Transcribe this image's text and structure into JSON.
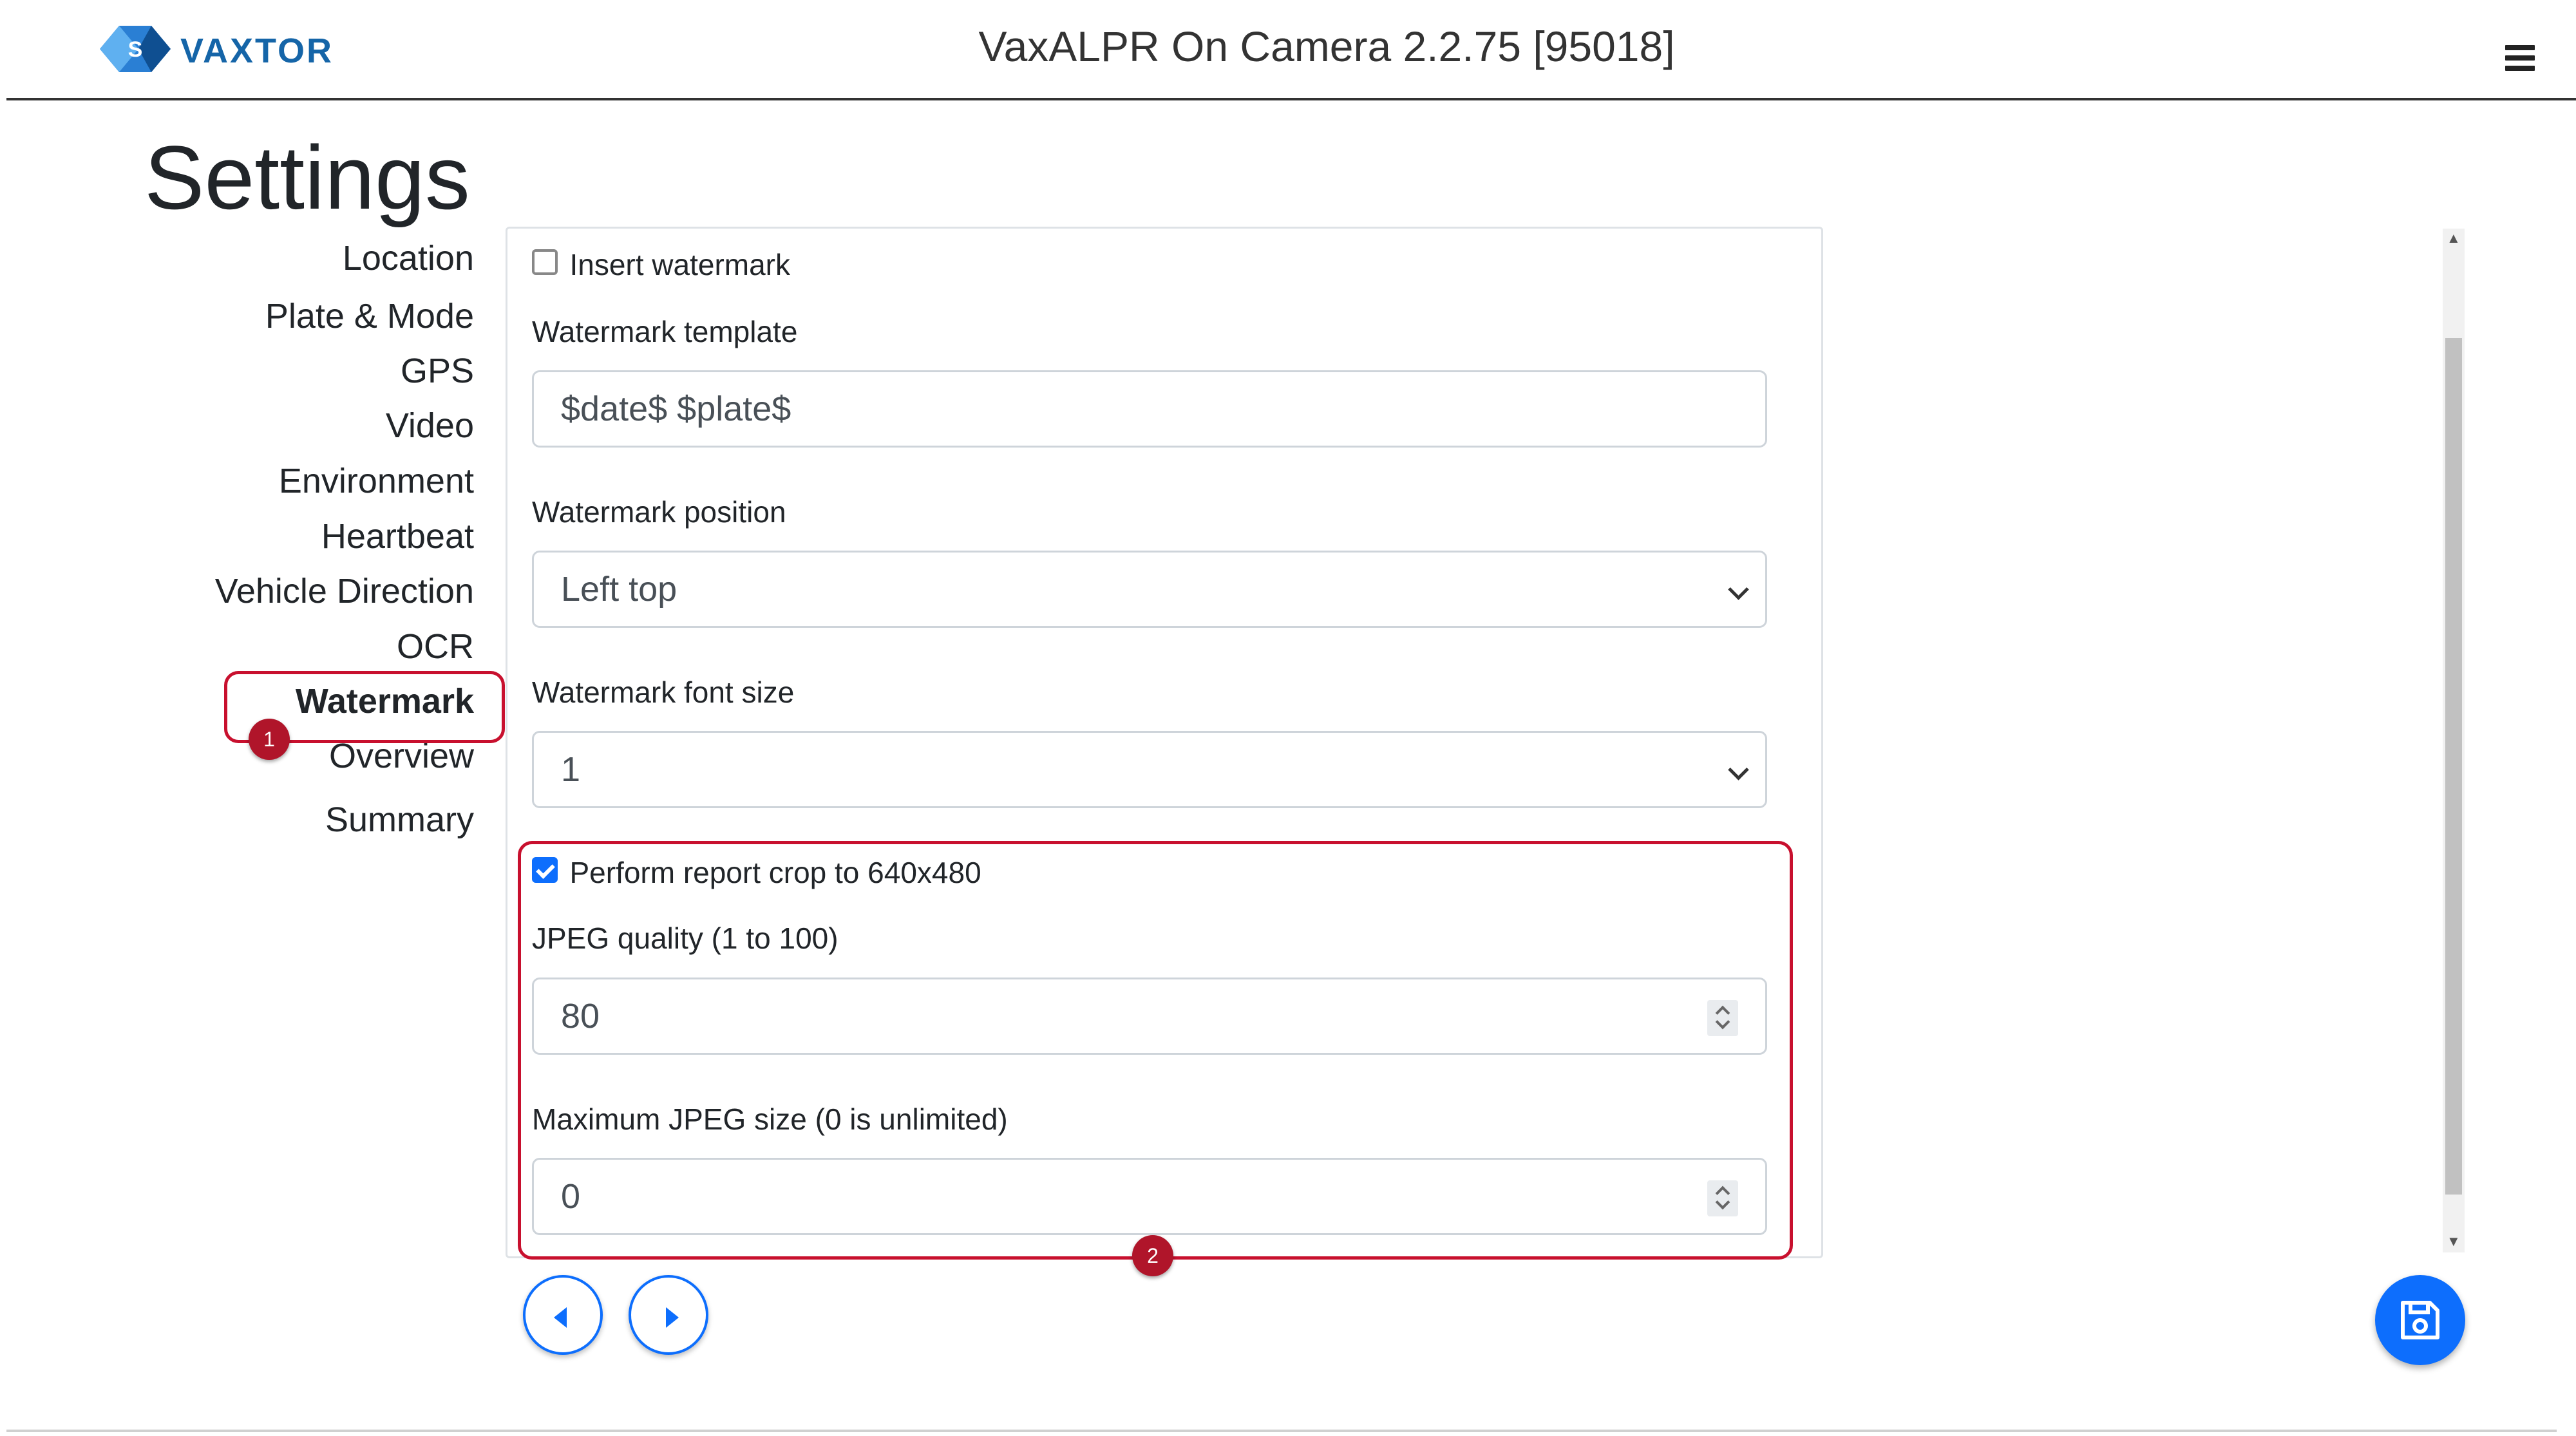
{
  "header": {
    "logo_text": "VAXTOR",
    "app_title": "VaxALPR On Camera  2.2.75 [95018]",
    "menu_icon": "hamburger-icon"
  },
  "page": {
    "title": "Settings"
  },
  "sidebar": {
    "items": [
      {
        "label": "Location"
      },
      {
        "label": "Plate & Mode"
      },
      {
        "label": "GPS"
      },
      {
        "label": "Video"
      },
      {
        "label": "Environment"
      },
      {
        "label": "Heartbeat"
      },
      {
        "label": "Vehicle Direction"
      },
      {
        "label": "OCR"
      },
      {
        "label": "Watermark",
        "active": true
      },
      {
        "label": "Overview"
      },
      {
        "label": "Summary"
      }
    ]
  },
  "annotations": {
    "badge1": "1",
    "badge2": "2",
    "callout_color": "#c8102e"
  },
  "form": {
    "insert_watermark": {
      "label": "Insert watermark",
      "checked": false
    },
    "template": {
      "label": "Watermark template",
      "value": "$date$ $plate$"
    },
    "position": {
      "label": "Watermark position",
      "value": "Left top"
    },
    "font_size": {
      "label": "Watermark font size",
      "value": "1"
    },
    "crop": {
      "label": "Perform report crop to 640x480",
      "checked": true
    },
    "jpeg_quality": {
      "label": "JPEG quality (1 to 100)",
      "value": "80"
    },
    "max_jpeg": {
      "label": "Maximum JPEG size (0 is unlimited)",
      "value": "0"
    }
  },
  "buttons": {
    "prev_icon": "caret-left-icon",
    "next_icon": "caret-right-icon",
    "save_icon": "save-icon"
  },
  "colors": {
    "accent": "#0d6efd",
    "brand": "#1565a8",
    "callout": "#c8102e"
  }
}
